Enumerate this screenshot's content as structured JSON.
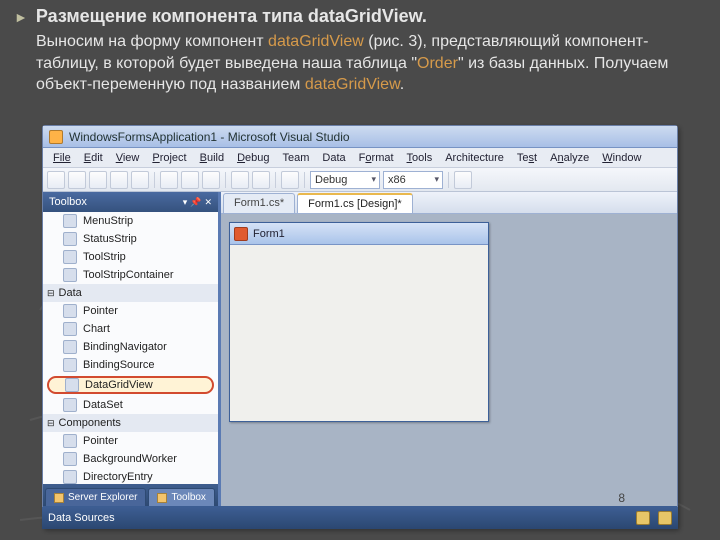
{
  "heading": {
    "marker": "►",
    "text": "Размещение компонента типа dataGridView."
  },
  "para": {
    "p1": "Выносим на форму компонент ",
    "hl1": "dataGridView",
    "p2": " (рис. 3), представляющий компонент-таблицу, в которой будет выведена наша таблица \"",
    "hl2": "Order",
    "p3": "\" из базы данных. Получаем объект-переменную под названием ",
    "hl3": "dataGridView",
    "p4": "."
  },
  "vs": {
    "title": "WindowsFormsApplication1 - Microsoft Visual Studio",
    "menu": [
      "File",
      "Edit",
      "View",
      "Project",
      "Build",
      "Debug",
      "Team",
      "Data",
      "Format",
      "Tools",
      "Architecture",
      "Test",
      "Analyze",
      "Window"
    ],
    "config": "Debug",
    "platform": "x86"
  },
  "toolbox": {
    "title": "Toolbox",
    "items_top": [
      "MenuStrip",
      "StatusStrip",
      "ToolStrip",
      "ToolStripContainer"
    ],
    "cat1": "Data",
    "items_data": [
      "Pointer",
      "Chart",
      "BindingNavigator",
      "BindingSource"
    ],
    "highlight": "DataGridView",
    "items_data2": [
      "DataSet"
    ],
    "cat2": "Components",
    "items_comp": [
      "Pointer",
      "BackgroundWorker",
      "DirectoryEntry"
    ],
    "tabs": {
      "left": "Server Explorer",
      "right": "Toolbox"
    }
  },
  "docs": {
    "tab1": "Form1.cs*",
    "tab2": "Form1.cs [Design]*"
  },
  "form": {
    "title": "Form1"
  },
  "datasources": {
    "label": "Data Sources"
  },
  "pagenum": "8"
}
